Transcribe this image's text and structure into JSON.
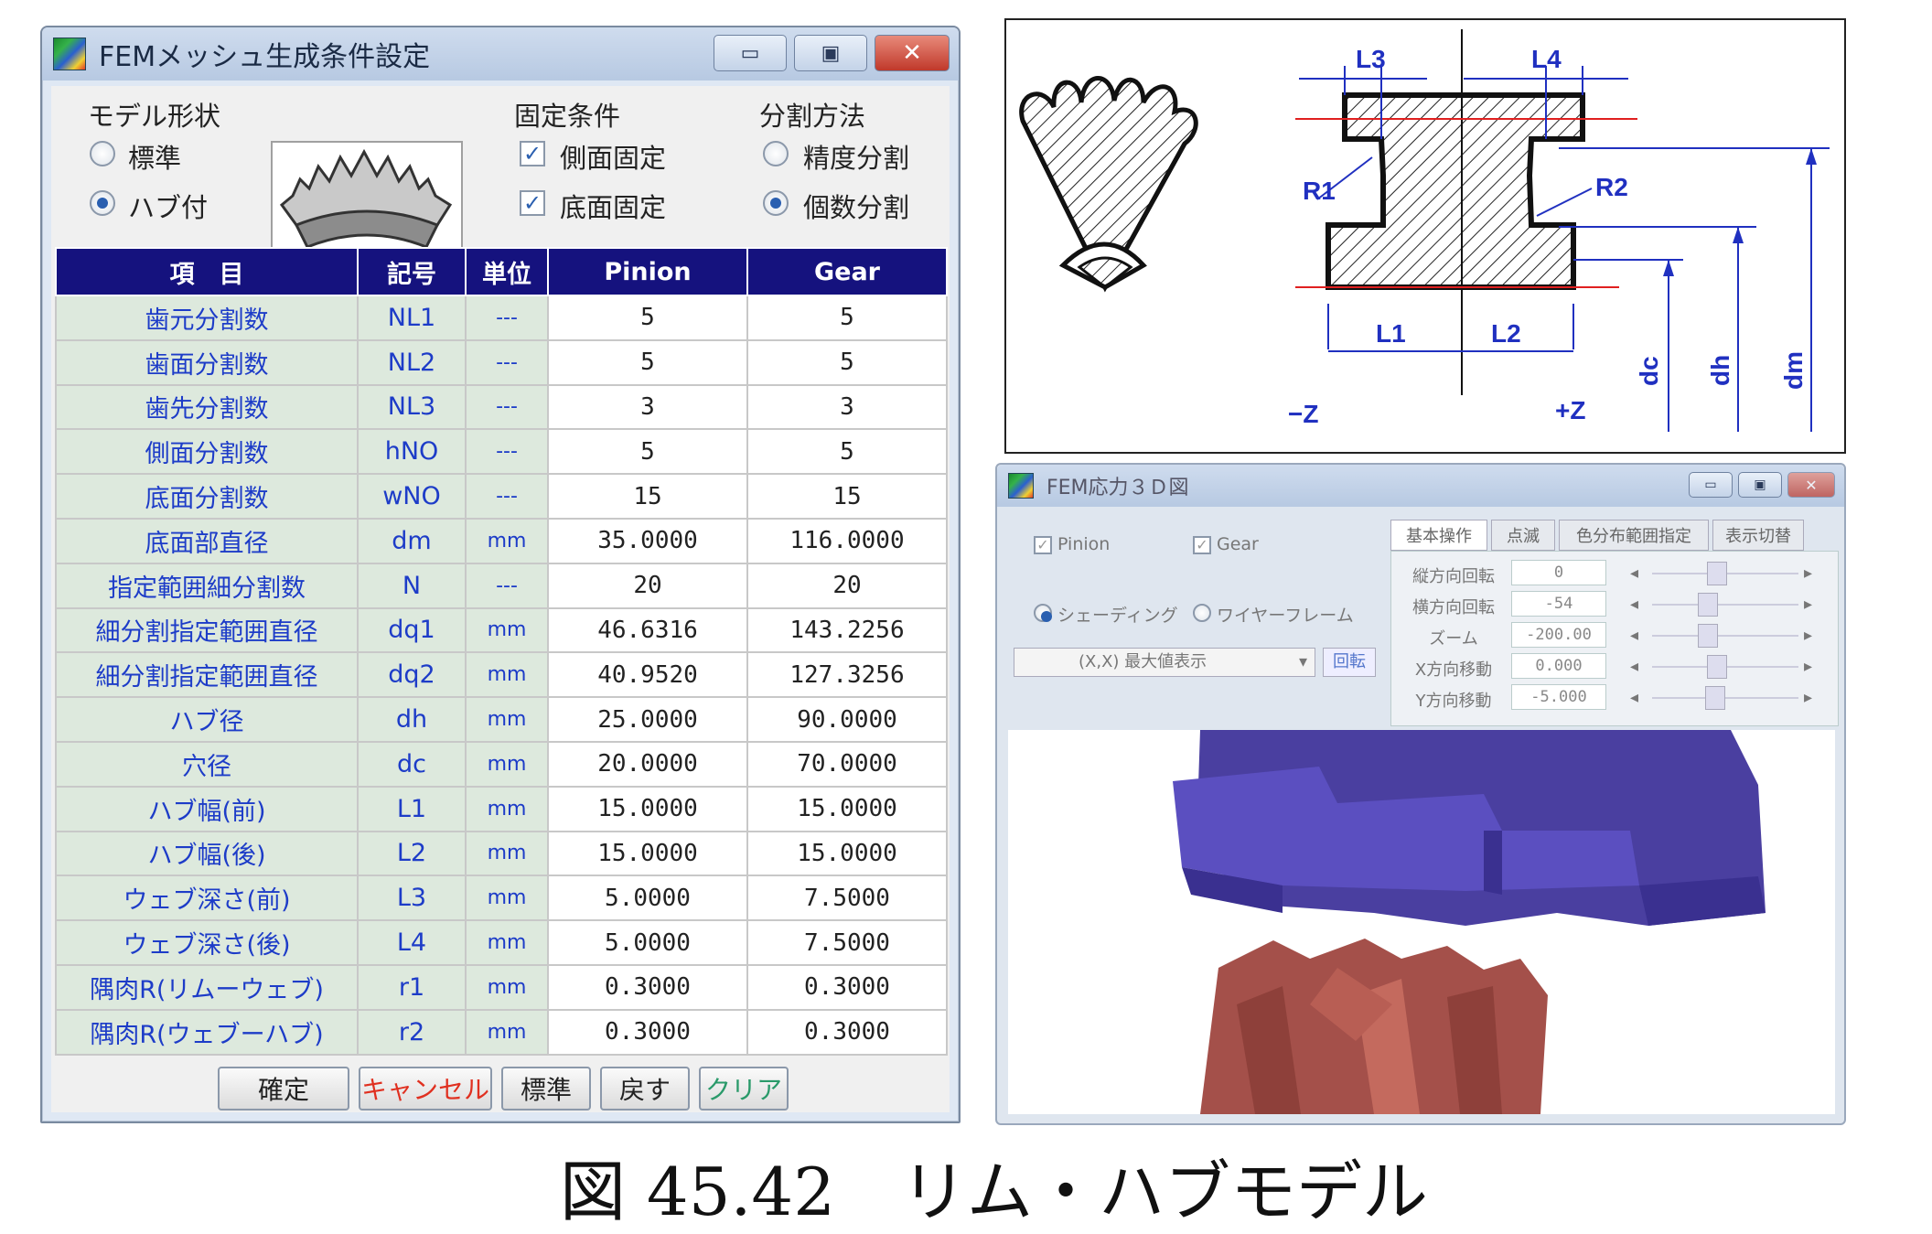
{
  "window": {
    "title": "FEMメッシュ生成条件設定"
  },
  "model_shape": {
    "title": "モデル形状",
    "options": [
      "標準",
      "ハブ付"
    ],
    "selected": "ハブ付"
  },
  "fixed": {
    "title": "固定条件",
    "options": [
      "側面固定",
      "底面固定"
    ]
  },
  "split": {
    "title": "分割方法",
    "options": [
      "精度分割",
      "個数分割"
    ],
    "selected": "個数分割"
  },
  "table": {
    "headers": [
      "項　目",
      "記号",
      "単位",
      "Pinion",
      "Gear"
    ],
    "rows": [
      [
        "歯元分割数",
        "NL1",
        "---",
        "5",
        "5"
      ],
      [
        "歯面分割数",
        "NL2",
        "---",
        "5",
        "5"
      ],
      [
        "歯先分割数",
        "NL3",
        "---",
        "3",
        "3"
      ],
      [
        "側面分割数",
        "hNO",
        "---",
        "5",
        "5"
      ],
      [
        "底面分割数",
        "wNO",
        "---",
        "15",
        "15"
      ],
      [
        "底面部直径",
        "dm",
        "mm",
        "35.0000",
        "116.0000"
      ],
      [
        "指定範囲細分割数",
        "N",
        "---",
        "20",
        "20"
      ],
      [
        "細分割指定範囲直径",
        "dq1",
        "mm",
        "46.6316",
        "143.2256"
      ],
      [
        "細分割指定範囲直径",
        "dq2",
        "mm",
        "40.9520",
        "127.3256"
      ],
      [
        "ハブ径",
        "dh",
        "mm",
        "25.0000",
        "90.0000"
      ],
      [
        "穴径",
        "dc",
        "mm",
        "20.0000",
        "70.0000"
      ],
      [
        "ハブ幅(前)",
        "L1",
        "mm",
        "15.0000",
        "15.0000"
      ],
      [
        "ハブ幅(後)",
        "L2",
        "mm",
        "15.0000",
        "15.0000"
      ],
      [
        "ウェブ深さ(前)",
        "L3",
        "mm",
        "5.0000",
        "7.5000"
      ],
      [
        "ウェブ深さ(後)",
        "L4",
        "mm",
        "5.0000",
        "7.5000"
      ],
      [
        "隅肉R(リムーウェブ)",
        "r1",
        "mm",
        "0.3000",
        "0.3000"
      ],
      [
        "隅肉R(ウェブーハブ)",
        "r2",
        "mm",
        "0.3000",
        "0.3000"
      ]
    ]
  },
  "buttons": {
    "ok": "確定",
    "cancel": "キャンセル",
    "standard": "標準",
    "back": "戻す",
    "clear": "クリア"
  },
  "diagram": {
    "labels": {
      "L1": "L1",
      "L2": "L2",
      "L3": "L3",
      "L4": "L4",
      "R1": "R1",
      "R2": "R2",
      "dc": "dc",
      "dh": "dh",
      "dm": "dm",
      "zminus": "−Z",
      "zplus": "+Z"
    }
  },
  "fem": {
    "title": "FEM応力３Ｄ図",
    "pinion": "Pinion",
    "gear": "Gear",
    "shading": "シェーディング",
    "wireframe": "ワイヤーフレーム",
    "dropdown": "(X,X) 最大値表示",
    "rotate": "回転",
    "tabs": [
      "基本操作",
      "点滅",
      "色分布範囲指定",
      "表示切替"
    ],
    "sliders": [
      {
        "label": "縦方向回転",
        "value": "0"
      },
      {
        "label": "横方向回転",
        "value": "-54"
      },
      {
        "label": "ズーム",
        "value": "-200.00"
      },
      {
        "label": "X方向移動",
        "value": "0.000"
      },
      {
        "label": "Y方向移動",
        "value": "-5.000"
      }
    ],
    "colors": {
      "gear": "#4a3fa0",
      "pinion": "#a4504a"
    }
  },
  "caption": "図 45.42　リム・ハブモデル"
}
